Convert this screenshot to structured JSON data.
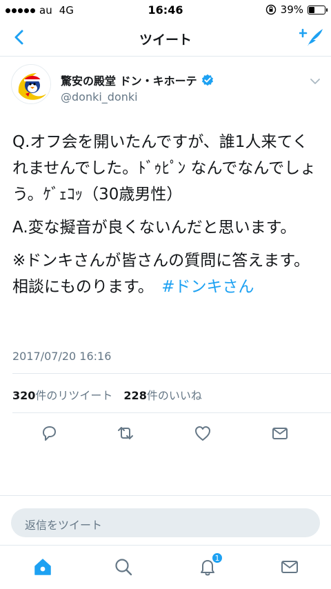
{
  "status_bar": {
    "carrier": "au",
    "network": "4G",
    "time": "16:46",
    "battery": "39%",
    "battery_level": 0.39,
    "signal_bars": 5
  },
  "nav": {
    "title": "ツイート",
    "back_icon": "chevron-left-icon",
    "compose_icon": "compose-tweet-icon"
  },
  "tweet": {
    "author_name": "驚安の殿堂 ドン・キホーテ",
    "handle": "@donki_donki",
    "verified": true,
    "paragraphs": [
      "Q.オフ会を開いたんですが、誰1人来てくれませんでした。ﾄﾞｩﾋﾟﾝ なんでなんでしょう。ｹﾞｪｺｯ（30歳男性）",
      "A.変な擬音が良くないんだと思います。"
    ],
    "last_paragraph_text": "※ドンキさんが皆さんの質問に答えます。相談にものります。",
    "hashtag": "#ドンキさん",
    "timestamp": "2017/07/20 16:16",
    "retweet_count": "320",
    "retweet_label": "件のリツイート",
    "like_count": "228",
    "like_label": "件のいいね"
  },
  "reply": {
    "placeholder": "返信をツイート"
  },
  "tabbar": {
    "notification_badge": "1"
  },
  "colors": {
    "accent": "#1da1f2",
    "secondary_text": "#657786",
    "divider": "#e1e8ed"
  }
}
